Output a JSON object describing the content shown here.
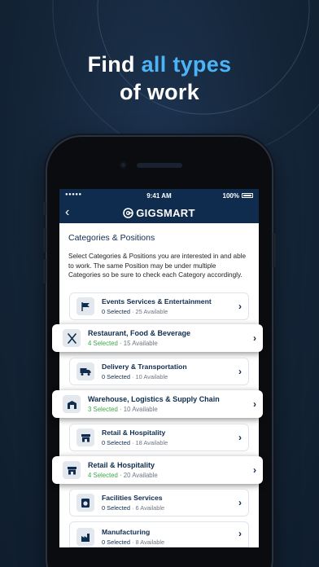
{
  "headline": {
    "line1_prefix": "Find ",
    "line1_accent": "all types",
    "line2": "of work"
  },
  "colors": {
    "accent": "#4cb3f5",
    "navy": "#0f2c4f",
    "selected_green": "#3ea74b",
    "background": "#142538"
  },
  "statusbar": {
    "signal": "●●●●● ",
    "time": "9:41 AM",
    "battery": "100%"
  },
  "navbar": {
    "back_icon": "‹",
    "brand": "GIGSMART"
  },
  "page": {
    "title": "Categories & Positions",
    "description": "Select Categories & Positions you are interested in and able to work. The same Position may be under multiple Categories so be sure to check each Category accordingly."
  },
  "categories": [
    {
      "title": "Events Services & Entertainment",
      "selected": "0 Selected",
      "available": "25 Available",
      "icon": "flag-icon",
      "elevated": false
    },
    {
      "title": "Restaurant, Food & Beverage",
      "selected": "4 Selected",
      "available": "15 Available",
      "icon": "utensils-icon",
      "elevated": true
    },
    {
      "title": "Delivery & Transportation",
      "selected": "0 Selected",
      "available": "10 Available",
      "icon": "truck-icon",
      "elevated": false
    },
    {
      "title": "Warehouse, Logistics & Supply Chain",
      "selected": "3 Selected",
      "available": "10 Available",
      "icon": "warehouse-icon",
      "elevated": true
    },
    {
      "title": "Retail & Hospitality",
      "selected": "0 Selected",
      "available": "18 Available",
      "icon": "store-icon",
      "elevated": false
    },
    {
      "title": "Retail & Hospitality",
      "selected": "4 Selected",
      "available": "20 Available",
      "icon": "store-icon",
      "elevated": true
    },
    {
      "title": "Facilities Services",
      "selected": "0 Selected",
      "available": "6 Available",
      "icon": "washer-icon",
      "elevated": false
    },
    {
      "title": "Manufacturing",
      "selected": "0 Selected",
      "available": "8 Available",
      "icon": "factory-icon",
      "elevated": false
    }
  ],
  "separator": " · ",
  "chevron": "›"
}
